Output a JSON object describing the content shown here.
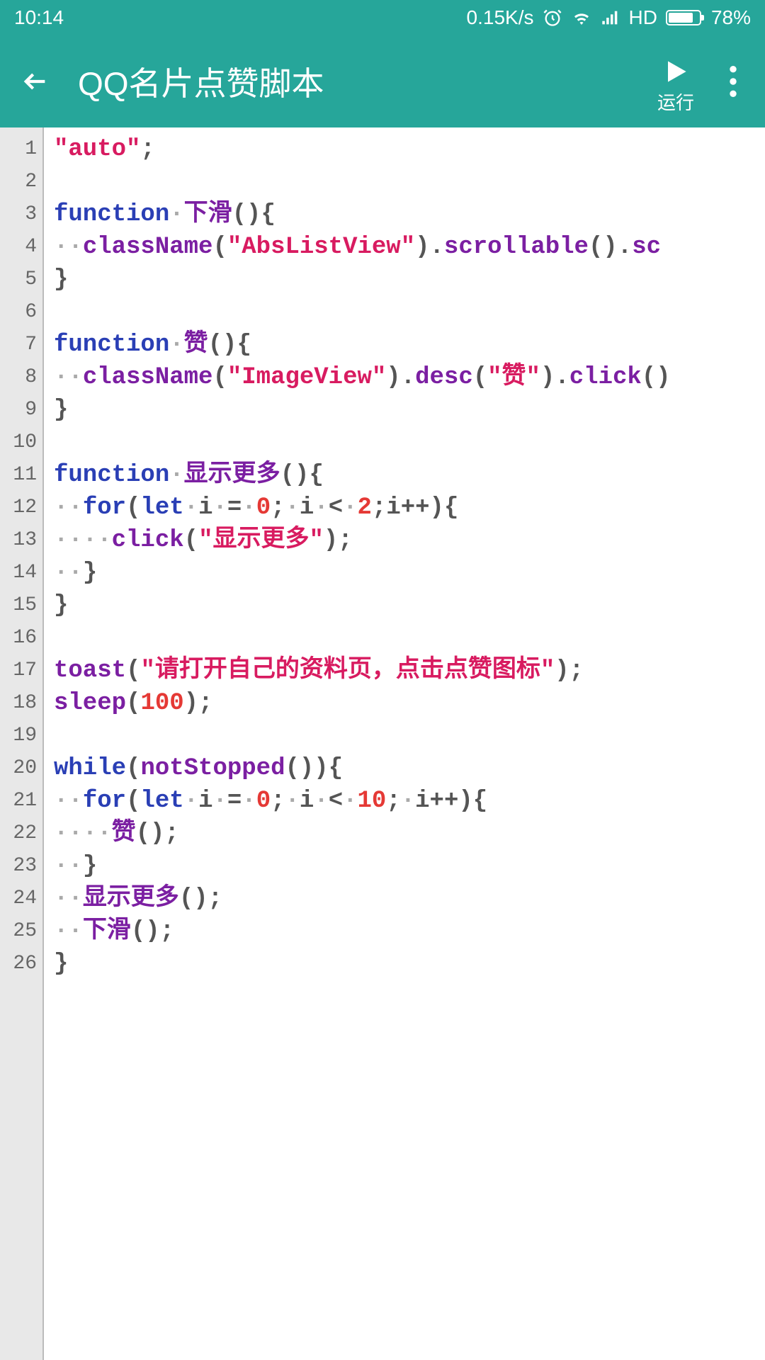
{
  "status": {
    "time": "10:14",
    "speed": "0.15K/s",
    "hd": "HD",
    "battery": "78%"
  },
  "header": {
    "title": "QQ名片点赞脚本",
    "run_label": "运行"
  },
  "code": {
    "lines": [
      [
        {
          "t": "s",
          "v": "\"auto\""
        },
        {
          "t": "p",
          "v": ";"
        }
      ],
      [],
      [
        {
          "t": "k",
          "v": "function"
        },
        {
          "t": "dot",
          "v": "·"
        },
        {
          "t": "f",
          "v": "下滑"
        },
        {
          "t": "p",
          "v": "(){"
        }
      ],
      [
        {
          "t": "dot",
          "v": "··"
        },
        {
          "t": "f",
          "v": "className"
        },
        {
          "t": "p",
          "v": "("
        },
        {
          "t": "s",
          "v": "\"AbsListView\""
        },
        {
          "t": "p",
          "v": ")."
        },
        {
          "t": "f",
          "v": "scrollable"
        },
        {
          "t": "p",
          "v": "()."
        },
        {
          "t": "f",
          "v": "sc"
        }
      ],
      [
        {
          "t": "p",
          "v": "}"
        }
      ],
      [],
      [
        {
          "t": "k",
          "v": "function"
        },
        {
          "t": "dot",
          "v": "·"
        },
        {
          "t": "f",
          "v": "赞"
        },
        {
          "t": "p",
          "v": "(){"
        }
      ],
      [
        {
          "t": "dot",
          "v": "··"
        },
        {
          "t": "f",
          "v": "className"
        },
        {
          "t": "p",
          "v": "("
        },
        {
          "t": "s",
          "v": "\"ImageView\""
        },
        {
          "t": "p",
          "v": ")."
        },
        {
          "t": "f",
          "v": "desc"
        },
        {
          "t": "p",
          "v": "("
        },
        {
          "t": "s",
          "v": "\"赞\""
        },
        {
          "t": "p",
          "v": ")."
        },
        {
          "t": "f",
          "v": "click"
        },
        {
          "t": "p",
          "v": "()"
        }
      ],
      [
        {
          "t": "p",
          "v": "}"
        }
      ],
      [],
      [
        {
          "t": "k",
          "v": "function"
        },
        {
          "t": "dot",
          "v": "·"
        },
        {
          "t": "f",
          "v": "显示更多"
        },
        {
          "t": "p",
          "v": "(){"
        }
      ],
      [
        {
          "t": "dot",
          "v": "··"
        },
        {
          "t": "k",
          "v": "for"
        },
        {
          "t": "p",
          "v": "("
        },
        {
          "t": "k",
          "v": "let"
        },
        {
          "t": "dot",
          "v": "·"
        },
        {
          "t": "p",
          "v": "i"
        },
        {
          "t": "dot",
          "v": "·"
        },
        {
          "t": "p",
          "v": "="
        },
        {
          "t": "dot",
          "v": "·"
        },
        {
          "t": "n",
          "v": "0"
        },
        {
          "t": "p",
          "v": ";"
        },
        {
          "t": "dot",
          "v": "·"
        },
        {
          "t": "p",
          "v": "i"
        },
        {
          "t": "dot",
          "v": "·"
        },
        {
          "t": "p",
          "v": "<"
        },
        {
          "t": "dot",
          "v": "·"
        },
        {
          "t": "n",
          "v": "2"
        },
        {
          "t": "p",
          "v": ";i++){"
        }
      ],
      [
        {
          "t": "dot",
          "v": "····"
        },
        {
          "t": "f",
          "v": "click"
        },
        {
          "t": "p",
          "v": "("
        },
        {
          "t": "s",
          "v": "\"显示更多\""
        },
        {
          "t": "p",
          "v": ");"
        }
      ],
      [
        {
          "t": "dot",
          "v": "··"
        },
        {
          "t": "p",
          "v": "}"
        }
      ],
      [
        {
          "t": "p",
          "v": "}"
        }
      ],
      [],
      [
        {
          "t": "f",
          "v": "toast"
        },
        {
          "t": "p",
          "v": "("
        },
        {
          "t": "s",
          "v": "\"请打开自己的资料页，点击点赞图标\""
        },
        {
          "t": "p",
          "v": ");"
        }
      ],
      [
        {
          "t": "f",
          "v": "sleep"
        },
        {
          "t": "p",
          "v": "("
        },
        {
          "t": "n",
          "v": "100"
        },
        {
          "t": "p",
          "v": ");"
        }
      ],
      [],
      [
        {
          "t": "k",
          "v": "while"
        },
        {
          "t": "p",
          "v": "("
        },
        {
          "t": "f",
          "v": "notStopped"
        },
        {
          "t": "p",
          "v": "()){"
        }
      ],
      [
        {
          "t": "dot",
          "v": "··"
        },
        {
          "t": "k",
          "v": "for"
        },
        {
          "t": "p",
          "v": "("
        },
        {
          "t": "k",
          "v": "let"
        },
        {
          "t": "dot",
          "v": "·"
        },
        {
          "t": "p",
          "v": "i"
        },
        {
          "t": "dot",
          "v": "·"
        },
        {
          "t": "p",
          "v": "="
        },
        {
          "t": "dot",
          "v": "·"
        },
        {
          "t": "n",
          "v": "0"
        },
        {
          "t": "p",
          "v": ";"
        },
        {
          "t": "dot",
          "v": "·"
        },
        {
          "t": "p",
          "v": "i"
        },
        {
          "t": "dot",
          "v": "·"
        },
        {
          "t": "p",
          "v": "<"
        },
        {
          "t": "dot",
          "v": "·"
        },
        {
          "t": "n",
          "v": "10"
        },
        {
          "t": "p",
          "v": ";"
        },
        {
          "t": "dot",
          "v": "·"
        },
        {
          "t": "p",
          "v": "i++){"
        }
      ],
      [
        {
          "t": "dot",
          "v": "····"
        },
        {
          "t": "f",
          "v": "赞"
        },
        {
          "t": "p",
          "v": "();"
        }
      ],
      [
        {
          "t": "dot",
          "v": "··"
        },
        {
          "t": "p",
          "v": "}"
        }
      ],
      [
        {
          "t": "dot",
          "v": "··"
        },
        {
          "t": "f",
          "v": "显示更多"
        },
        {
          "t": "p",
          "v": "();"
        }
      ],
      [
        {
          "t": "dot",
          "v": "··"
        },
        {
          "t": "f",
          "v": "下滑"
        },
        {
          "t": "p",
          "v": "();"
        }
      ],
      [
        {
          "t": "p",
          "v": "}"
        }
      ]
    ]
  }
}
